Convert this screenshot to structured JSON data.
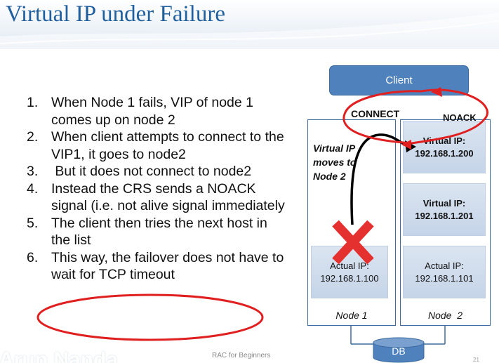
{
  "slide": {
    "title": "Virtual IP under Failure",
    "steps": [
      {
        "num": "1.",
        "text": "When Node 1 fails, VIP of node 1 comes up on node 2"
      },
      {
        "num": "2.",
        "text": "When client attempts to connect to the VIP1, it goes to node2"
      },
      {
        "num": "3.",
        "text": " But it does not connect to node2"
      },
      {
        "num": "4.",
        "text": "Instead the CRS sends a NOACK signal (i.e. not alive signal immediately"
      },
      {
        "num": "5.",
        "text": "The client then tries the next host in the list"
      },
      {
        "num": "6.",
        "text": "This way, the failover does not have to wait for TCP timeout"
      }
    ]
  },
  "diagram": {
    "client": "Client",
    "connect": "CONNECT",
    "noack": "NOACK",
    "moves": "Virtual IP moves to Node 2",
    "node1": {
      "label": "Node 1",
      "actual_ip": {
        "label": "Actual IP:",
        "value": "192.168.1.100"
      }
    },
    "node2": {
      "label": "Node  2",
      "vip_a": {
        "label": "Virtual IP:",
        "value": "192.168.1.200"
      },
      "vip_b": {
        "label": "Virtual IP:",
        "value": "192.168.1.201"
      },
      "actual_ip": {
        "label": "Actual IP:",
        "value": "192.168.1.101"
      }
    },
    "db": "DB"
  },
  "footer": {
    "brand": "Arup Nanda",
    "center": "RAC for Beginners",
    "page": "21"
  },
  "colors": {
    "title": "#1f5f9e",
    "client_fill": "#4f81bd",
    "ip_fill": "#c5d4e8",
    "highlight_red": "#e02020"
  }
}
